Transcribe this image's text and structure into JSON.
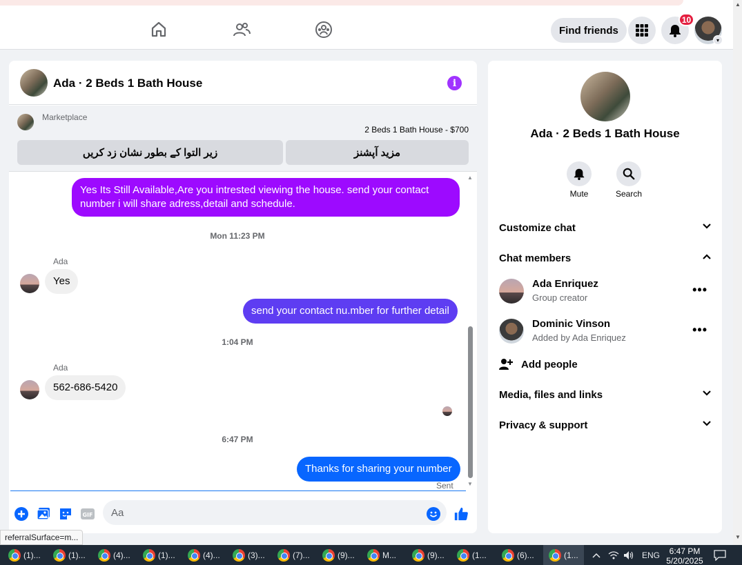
{
  "header": {
    "find_friends": "Find friends",
    "notification_count": "10"
  },
  "chat": {
    "title": "Ada · 2 Beds 1 Bath House",
    "marketplace_label": "Marketplace",
    "listing": "2 Beds 1 Bath House - $700",
    "btn_mark_sold": "زیر التوا کے بطور نشان زد کریں",
    "btn_more_options": "مزید آپشنز",
    "messages": [
      {
        "text": "Yes Its Still Available,Are you intrested viewing the house. send your contact number i will share adress,detail and schedule."
      },
      {
        "timestamp": "Mon 11:23 PM"
      },
      {
        "sender": "Ada",
        "text": "Yes"
      },
      {
        "text": "send your contact nu.mber for further detail"
      },
      {
        "timestamp": "1:04 PM"
      },
      {
        "sender": "Ada",
        "text": "562-686-5420"
      },
      {
        "timestamp": "6:47 PM"
      },
      {
        "text": "Thanks for sharing your number"
      }
    ],
    "status": "Sent",
    "input_placeholder": "Aa"
  },
  "side": {
    "title": "Ada · 2 Beds 1 Bath House",
    "mute_label": "Mute",
    "search_label": "Search",
    "customize_chat": "Customize chat",
    "chat_members": "Chat members",
    "members": [
      {
        "name": "Ada Enriquez",
        "role": "Group creator"
      },
      {
        "name": "Dominic Vinson",
        "role": "Added by Ada Enriquez"
      }
    ],
    "add_people": "Add people",
    "media_files_links": "Media, files and links",
    "privacy_support": "Privacy & support"
  },
  "tooltip": "referralSurface=m...",
  "taskbar": {
    "tasks": [
      "(1)...",
      "(1)...",
      "(4)...",
      "(1)...",
      "(4)...",
      "(3)...",
      "(7)...",
      "(9)...",
      "M...",
      "(9)...",
      "(1...",
      "(6)...",
      "(1..."
    ],
    "language": "ENG",
    "time": "6:47 PM",
    "date": "5/20/2025"
  },
  "colors": {
    "bubble_purple": "#9d0aff",
    "bubble_violet": "#5e3df2",
    "bubble_blue": "#0866ff",
    "accent": "#1877f2",
    "notification_red": "#e41e3f"
  }
}
